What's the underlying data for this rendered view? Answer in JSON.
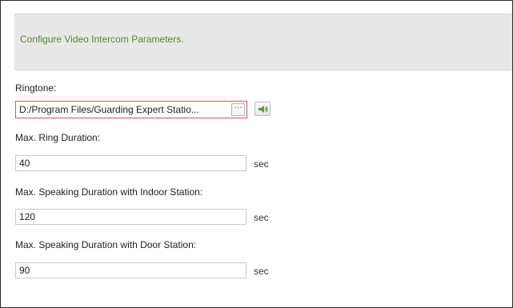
{
  "banner": {
    "text": "Configure Video Intercom Parameters."
  },
  "ringtone": {
    "label": "Ringtone:",
    "value": "D:/Program Files/Guarding Expert Statio...",
    "browse_label": "···",
    "play_icon": "speaker-icon"
  },
  "max_ring_duration": {
    "label": "Max. Ring Duration:",
    "value": "40",
    "unit": "sec"
  },
  "max_speaking_indoor": {
    "label": "Max. Speaking Duration with Indoor Station:",
    "value": "120",
    "unit": "sec"
  },
  "max_speaking_door": {
    "label": "Max. Speaking Duration with Door Station:",
    "value": "90",
    "unit": "sec"
  },
  "colors": {
    "banner_text": "#4f8a2b",
    "banner_bg": "#e8e8e8",
    "invalid_border": "#d9534f",
    "speaker_icon": "#5a9e2f"
  }
}
